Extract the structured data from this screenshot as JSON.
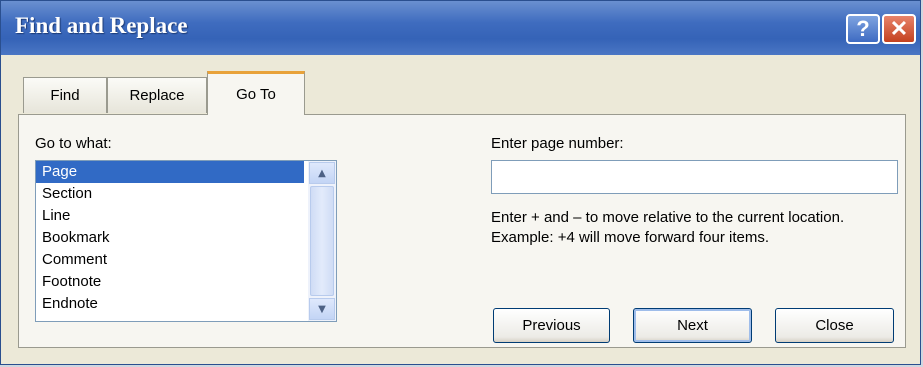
{
  "window": {
    "title": "Find and Replace",
    "help_glyph": "?",
    "close_glyph": "✕"
  },
  "tabs": [
    {
      "label": "Find",
      "active": false
    },
    {
      "label": "Replace",
      "active": false
    },
    {
      "label": "Go To",
      "active": true
    }
  ],
  "goto": {
    "list_label": "Go to what:",
    "items": [
      "Page",
      "Section",
      "Line",
      "Bookmark",
      "Comment",
      "Footnote",
      "Endnote"
    ],
    "selected": "Page",
    "page_label": "Enter page number:",
    "page_value": "",
    "help": "Enter + and – to move relative to the current location. Example: +4 will move forward four items."
  },
  "buttons": {
    "previous": "Previous",
    "next": "Next",
    "close": "Close"
  },
  "icons": {
    "help": "help-icon",
    "close": "close-icon",
    "scroll_up": "chevron-up-icon",
    "scroll_down": "chevron-down-icon"
  },
  "colors": {
    "title_bar": "#3563b7",
    "active_tab_accent": "#e8a23a",
    "selection": "#316ac5"
  }
}
